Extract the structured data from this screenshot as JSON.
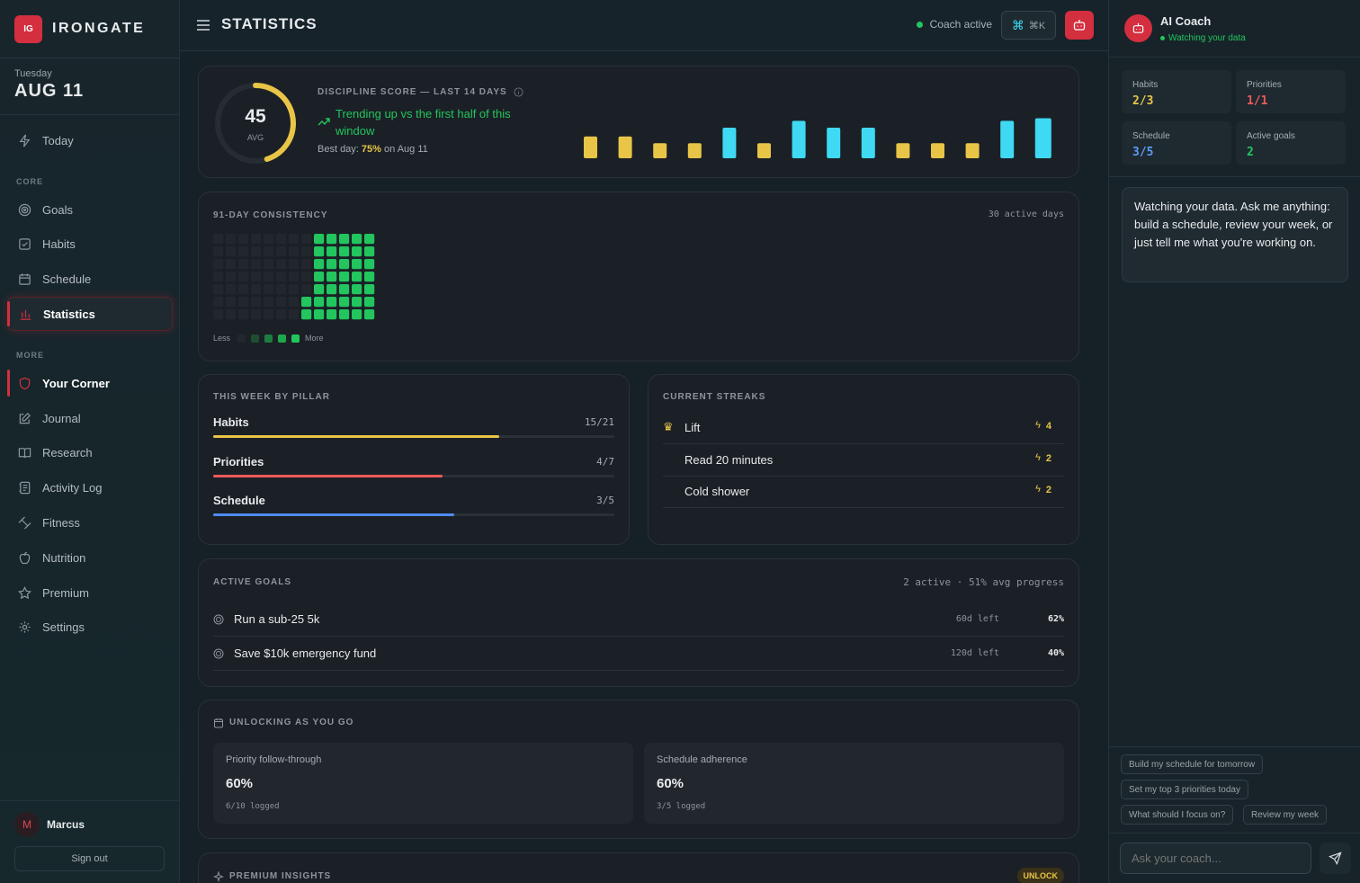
{
  "brand": {
    "mark": "IG",
    "name": "IRONGATE"
  },
  "date": {
    "weekday": "Tuesday",
    "display": "AUG 11"
  },
  "nav": {
    "today": "Today",
    "core_label": "CORE",
    "goals": "Goals",
    "habits": "Habits",
    "schedule": "Schedule",
    "statistics": "Statistics",
    "more_label": "MORE",
    "corner": "Your Corner",
    "journal": "Journal",
    "research": "Research",
    "activity": "Activity Log",
    "fitness": "Fitness",
    "nutrition": "Nutrition",
    "premium": "Premium",
    "settings": "Settings"
  },
  "user": {
    "initial": "M",
    "name": "Marcus",
    "signout": "Sign out"
  },
  "topbar": {
    "title": "STATISTICS",
    "coach_status": "Coach active",
    "shortcut": "⌘K"
  },
  "discipline": {
    "score": "45",
    "score_label": "AVG",
    "score_fraction": 0.45,
    "title": "DISCIPLINE SCORE — LAST 14 DAYS",
    "trend": "Trending up vs the first half of this window",
    "best_prefix": "Best day:",
    "best_value": "75%",
    "best_suffix": "on Aug 11"
  },
  "chart_data": {
    "type": "bar",
    "title": "DISCIPLINE SCORE — LAST 14 DAYS",
    "values": [
      35,
      35,
      22,
      22,
      52,
      22,
      65,
      52,
      52,
      22,
      22,
      22,
      65,
      70
    ],
    "colors": {
      "low": "#e8c547",
      "high": "#3fd9f3"
    },
    "ylim": [
      0,
      100
    ]
  },
  "consistency": {
    "title": "91-DAY CONSISTENCY",
    "summary": "30 active days",
    "legend_less": "Less",
    "legend_more": "More"
  },
  "pillars": {
    "title": "THIS WEEK BY PILLAR",
    "items": [
      {
        "name": "Habits",
        "value": "15/21",
        "fraction": 0.714,
        "color": "#e8c547"
      },
      {
        "name": "Priorities",
        "value": "4/7",
        "fraction": 0.571,
        "color": "#ef5a5a"
      },
      {
        "name": "Schedule",
        "value": "3/5",
        "fraction": 0.6,
        "color": "#4f8df0"
      }
    ]
  },
  "streaks": {
    "title": "CURRENT STREAKS",
    "items": [
      {
        "name": "Lift",
        "count": "4"
      },
      {
        "name": "Read 20 minutes",
        "count": "2"
      },
      {
        "name": "Cold shower",
        "count": "2"
      }
    ]
  },
  "goals": {
    "title": "ACTIVE GOALS",
    "summary": "2 active · 51% avg progress",
    "items": [
      {
        "name": "Run a sub-25 5k",
        "left": "60d left",
        "pct": "62%"
      },
      {
        "name": "Save $10k emergency fund",
        "left": "120d left",
        "pct": "40%"
      }
    ]
  },
  "unlocking": {
    "title": "UNLOCKING AS YOU GO",
    "items": [
      {
        "name": "Priority follow-through",
        "value": "60%",
        "detail": "6/10 logged"
      },
      {
        "name": "Schedule adherence",
        "value": "60%",
        "detail": "3/5 logged"
      }
    ]
  },
  "premium": {
    "title": "PREMIUM INSIGHTS",
    "badge": "UNLOCK"
  },
  "coach": {
    "title": "AI Coach",
    "status": "Watching your data",
    "stats": [
      {
        "name": "Habits",
        "value": "2/3",
        "color": "#e8c547"
      },
      {
        "name": "Priorities",
        "value": "1/1",
        "color": "#ef5a5a"
      },
      {
        "name": "Schedule",
        "value": "3/5",
        "color": "#5b9bf5"
      },
      {
        "name": "Active goals",
        "value": "2",
        "color": "#22c55e"
      }
    ],
    "message": "Watching your data. Ask me anything: build a schedule, review your week, or just tell me what you're working on.",
    "chips": [
      "Build my schedule for tomorrow",
      "Set my top 3 priorities today",
      "What should I focus on?",
      "Review my week"
    ],
    "placeholder": "Ask your coach..."
  }
}
